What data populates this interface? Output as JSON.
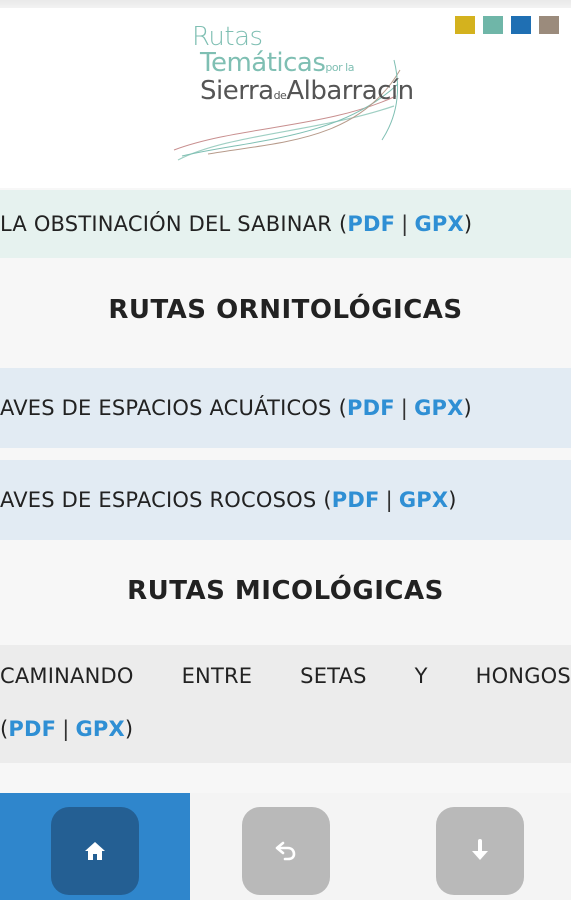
{
  "header": {
    "logo": {
      "line1": "Rutas",
      "line2_main": "Temáticas",
      "line2_small": "por la",
      "line3_main": "Sierra",
      "line3_small": "de",
      "line3_end": "Albarracín"
    },
    "swatches": [
      "#d4b21e",
      "#6fb6a8",
      "#1f6fb3",
      "#9b8b7c"
    ]
  },
  "routes": {
    "sabinar": {
      "name": "LA OBSTINACIÓN DEL SABINAR",
      "pdf": "PDF",
      "gpx": "GPX"
    },
    "acuaticos": {
      "name": "AVES DE ESPACIOS ACUÁTICOS",
      "pdf": "PDF",
      "gpx": "GPX"
    },
    "rocosos": {
      "name": "AVES DE ESPACIOS ROCOSOS",
      "pdf": "PDF",
      "gpx": "GPX"
    },
    "setas": {
      "words": [
        "CAMINANDO",
        "ENTRE",
        "SETAS",
        "Y",
        "HONGOS"
      ],
      "pdf": "PDF",
      "gpx": "GPX"
    }
  },
  "sections": {
    "ornitologicas": "RUTAS ORNITOLÓGICAS",
    "micologicas": "RUTAS MICOLÓGICAS"
  },
  "punct": {
    "open": "(",
    "close": ")",
    "sep": "|"
  },
  "nav": {
    "home_icon": "home-icon",
    "back_icon": "back-arrow-icon",
    "down_icon": "download-arrow-icon",
    "active_color": "#2f86cc"
  }
}
